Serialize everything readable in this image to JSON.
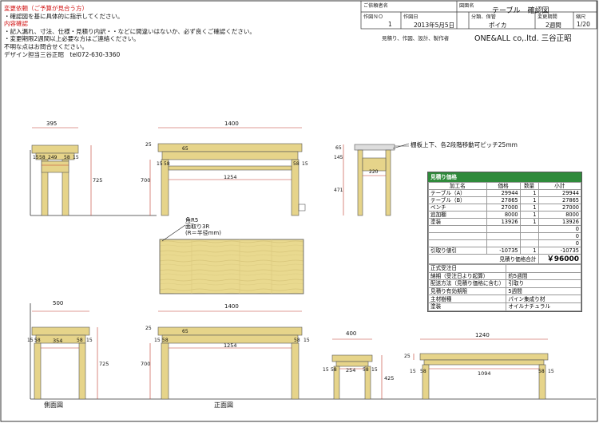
{
  "notes": {
    "change_title": "変更依頼（ご予算が見合う方）",
    "change_lines": [
      "・確認図を基に具体的に指示してください。"
    ],
    "check_title": "内容確認",
    "check_lines": [
      "・記入漏れ、寸法、仕様・見積り内訳・・などに間違いはないか、必ず良くご確認ください。",
      "・変更期限2週間以上必要な方はご連絡ください。",
      "不明な点はお問合せください。",
      "デザイン担当三谷正昭　tel072-630-3360"
    ]
  },
  "title_block": {
    "client_label": "ご依頼者名",
    "drawing_label": "図面名",
    "drawing_name": "テーブル　確認図",
    "no_label": "作図ＮＯ",
    "no_value": "1",
    "date_label": "作図日",
    "date_value": "2013年5月5日",
    "class_label": "分類、保管",
    "class_value": "ポイカ",
    "period_label": "変更期間",
    "period_value": "2週間",
    "page_label": "縮尺",
    "page_value": "1/20",
    "company_note": "見積り、作図、設計、製作者",
    "company": "ONE&ALL co,.ltd. 三谷正昭"
  },
  "annotations": {
    "shelf_note": "棚板上下、各2段階移動可ピッチ25mm",
    "corner_note": "角R5\n面取り3R\n(R＝半径mm)",
    "side_view": "側面図",
    "front_view": "正面図"
  },
  "dimensions": {
    "sv1": [
      "395",
      "249",
      "15",
      "58",
      "58",
      "15",
      "725"
    ],
    "fv1": [
      "1400",
      "25",
      "65",
      "1254",
      "15",
      "58",
      "58",
      "15",
      "700"
    ],
    "bench1": [
      "145",
      "65",
      "471",
      "220"
    ],
    "sv2": [
      "500",
      "354",
      "15",
      "58",
      "58",
      "15",
      "725"
    ],
    "fv2": [
      "1400",
      "25",
      "65",
      "1254",
      "15",
      "58",
      "58",
      "15",
      "700"
    ],
    "bench2_side": [
      "400",
      "254",
      "15",
      "58",
      "58",
      "15",
      "425"
    ],
    "bench2_front": [
      "1240",
      "1094",
      "25",
      "15",
      "58",
      "58",
      "15"
    ]
  },
  "estimate": {
    "title": "見積り価格",
    "headers": [
      "加工名",
      "価格",
      "数量",
      "小計"
    ],
    "rows": [
      [
        "テーブル（A）",
        "29944",
        "1",
        "29944"
      ],
      [
        "テーブル（B）",
        "27865",
        "1",
        "27865"
      ],
      [
        "ベンチ",
        "27000",
        "1",
        "27000"
      ],
      [
        "追加棚",
        "8000",
        "1",
        "8000"
      ],
      [
        "塗装",
        "13926",
        "1",
        "13926"
      ],
      [
        "",
        "",
        "",
        "0"
      ],
      [
        "",
        "",
        "",
        "0"
      ],
      [
        "",
        "",
        "",
        "0"
      ],
      [
        "引取り値引",
        "-10735",
        "1",
        "-10735"
      ]
    ],
    "total_label": "見積り価格合計",
    "total_value": "￥96000",
    "conditions": [
      [
        "正式受注日",
        ""
      ],
      [
        "納期（受注日より起算）",
        "約5週間"
      ],
      [
        "配送方法（見積り価格に含む）",
        "引取り"
      ],
      [
        "見積り有効期限",
        "5週間"
      ],
      [
        "主材樹種",
        "パイン集成り材"
      ],
      [
        "塗装",
        "オイルナチュラル"
      ]
    ]
  },
  "colors": {
    "wood": "#e6d48a",
    "wood_dark": "#c9b562",
    "dim": "#c0392b",
    "green": "#2f8a3b"
  }
}
